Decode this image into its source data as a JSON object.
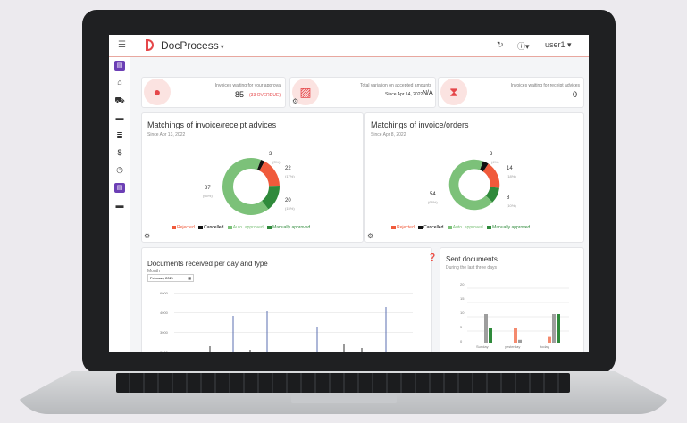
{
  "header": {
    "brand": "DocProcess",
    "user": "user1"
  },
  "colors": {
    "accent": "#e5474a",
    "rejected": "#f05a3b",
    "cancelled": "#111111",
    "auto": "#7cc179",
    "manual": "#2f8a3b"
  },
  "kpis": [
    {
      "title": "Invoices waiting for your approval",
      "value": "85",
      "note": "(33 OVERDUE)",
      "icon": "person-icon"
    },
    {
      "title": "Total variation on accepted amounts",
      "subtitle": "Since Apr 14, 2022",
      "value": "N/A",
      "icon": "percent-icon"
    },
    {
      "title": "Invoices waiting for receipt advices",
      "value": "0",
      "icon": "hourglass-icon"
    }
  ],
  "matching_receipt": {
    "title": "Matchings of invoice/receipt advices",
    "since": "Since Apr 13, 2022",
    "labels": [
      {
        "v": "3",
        "p": "(3%)"
      },
      {
        "v": "22",
        "p": "(17%)"
      },
      {
        "v": "20",
        "p": "(15%)"
      },
      {
        "v": "87",
        "p": "(65%)"
      }
    ]
  },
  "matching_orders": {
    "title": "Matchings of invoice/orders",
    "since": "Since Apr 8, 2022",
    "labels": [
      {
        "v": "3",
        "p": "(4%)"
      },
      {
        "v": "14",
        "p": "(18%)"
      },
      {
        "v": "8",
        "p": "(10%)"
      },
      {
        "v": "54",
        "p": "(68%)"
      }
    ]
  },
  "legend": {
    "rejected": "Rejected",
    "cancelled": "Cancelled",
    "auto": "Auto. approved",
    "manual": "Manually approved"
  },
  "docs_per_day": {
    "title": "Documents received per day and type",
    "month_label": "Month",
    "month_value": "February 2021",
    "yticks": [
      "6000",
      "4000",
      "3000",
      "2000"
    ]
  },
  "sent_docs": {
    "title": "Sent documents",
    "subtitle": "During the last three days",
    "yticks": [
      "20",
      "15",
      "10",
      "5",
      "0"
    ],
    "categories": [
      "Sunday",
      "yesterday",
      "today"
    ]
  },
  "chart_data": [
    {
      "type": "pie",
      "title": "Matchings of invoice/receipt advices",
      "categories": [
        "Cancelled",
        "Rejected",
        "Manually approved",
        "Auto. approved"
      ],
      "values": [
        3,
        22,
        20,
        87
      ]
    },
    {
      "type": "pie",
      "title": "Matchings of invoice/orders",
      "categories": [
        "Cancelled",
        "Rejected",
        "Manually approved",
        "Auto. approved"
      ],
      "values": [
        3,
        14,
        8,
        54
      ]
    },
    {
      "type": "bar",
      "title": "Sent documents",
      "categories": [
        "Sunday",
        "yesterday",
        "today"
      ],
      "ylim": [
        0,
        20
      ],
      "series": [
        {
          "values": [
            0,
            5,
            2
          ]
        },
        {
          "values": [
            10,
            1,
            10
          ]
        },
        {
          "values": [
            5,
            0,
            10
          ]
        }
      ]
    }
  ]
}
